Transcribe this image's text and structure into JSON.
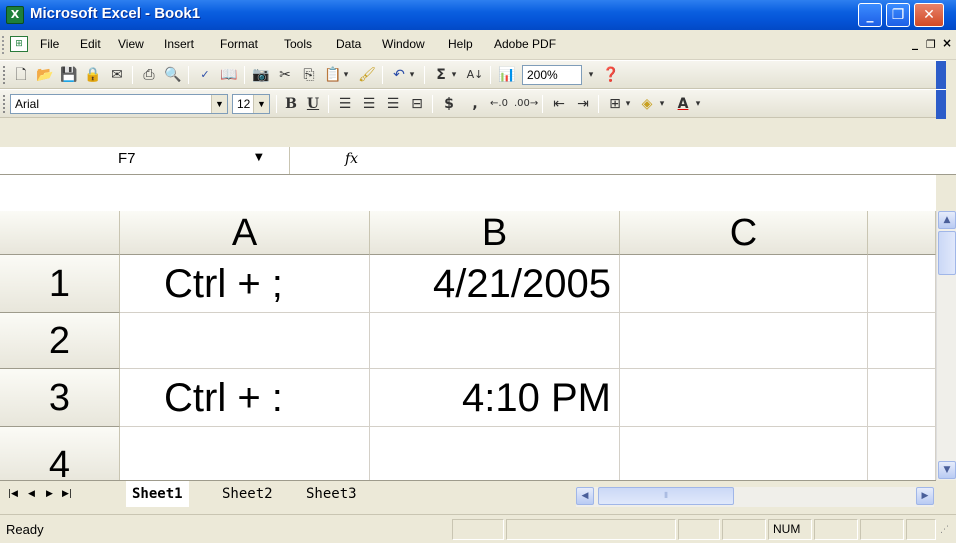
{
  "window": {
    "title": "Microsoft Excel - Book1",
    "app_icon": "excel-icon",
    "controls": {
      "minimize": "_",
      "restore": "❐",
      "close": "✕"
    }
  },
  "menubar": {
    "items": [
      "File",
      "Edit",
      "View",
      "Insert",
      "Format",
      "Tools",
      "Data",
      "Window",
      "Help",
      "Adobe PDF"
    ],
    "doc_controls": {
      "minimize": "_",
      "restore": "❐",
      "close": "×"
    }
  },
  "standard_toolbar": {
    "zoom": "200%"
  },
  "formatting_toolbar": {
    "font": "Arial",
    "size": "12",
    "bold": "B",
    "underline": "U",
    "currency": "$",
    "comma": ",",
    "font_color": "A"
  },
  "formula_bar": {
    "name_box": "F7",
    "fx_label": "fx",
    "formula": ""
  },
  "grid": {
    "columns": [
      "A",
      "B",
      "C"
    ],
    "rows": [
      {
        "num": "1",
        "a": "Ctrl + ;",
        "b": "4/21/2005",
        "c": ""
      },
      {
        "num": "2",
        "a": "",
        "b": "",
        "c": ""
      },
      {
        "num": "3",
        "a": "Ctrl + :",
        "b": "4:10 PM",
        "c": ""
      },
      {
        "num": "4",
        "a": "",
        "b": "",
        "c": ""
      }
    ]
  },
  "sheet_tabs": [
    "Sheet1",
    "Sheet2",
    "Sheet3"
  ],
  "active_sheet": "Sheet1",
  "status": {
    "text": "Ready",
    "num": "NUM"
  }
}
